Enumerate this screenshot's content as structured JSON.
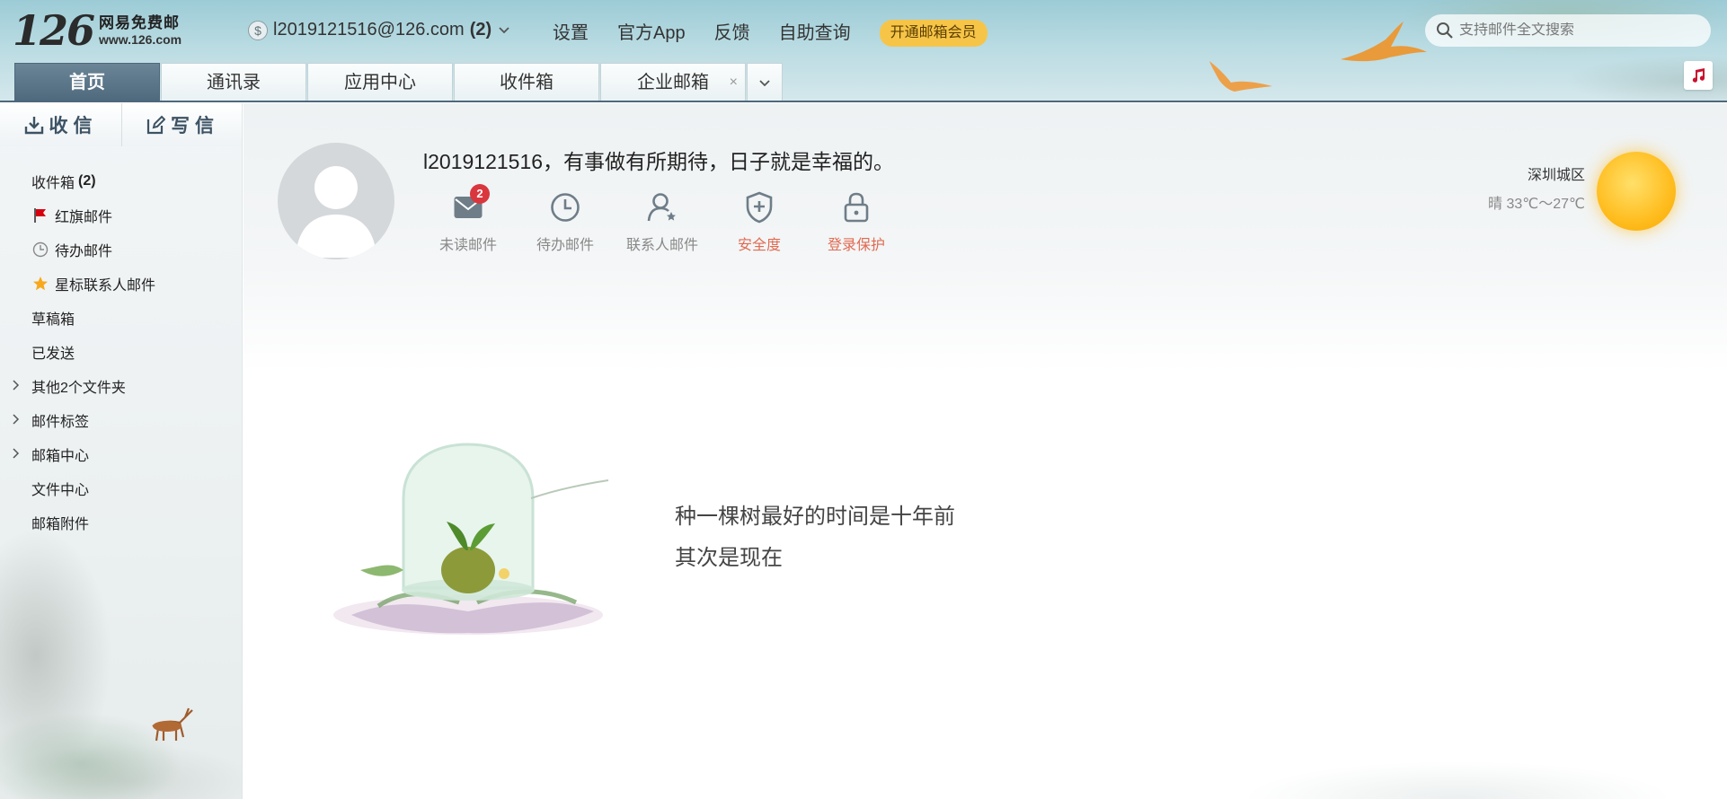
{
  "logo": {
    "number": "126",
    "line1": "网易免费邮",
    "line2": "www.126.com"
  },
  "account": {
    "email": "l2019121516@126.com",
    "count": "(2)"
  },
  "topnav": {
    "settings": "设置",
    "app": "官方App",
    "feedback": "反馈",
    "self_query": "自助查询",
    "vip": "开通邮箱会员"
  },
  "search": {
    "placeholder": "支持邮件全文搜索"
  },
  "tabs": [
    {
      "label": "首页"
    },
    {
      "label": "通讯录"
    },
    {
      "label": "应用中心"
    },
    {
      "label": "收件箱"
    },
    {
      "label": "企业邮箱"
    }
  ],
  "sidebar": {
    "receive": "收信",
    "compose": "写信",
    "folders": [
      {
        "label": "收件箱",
        "count": "(2)"
      },
      {
        "label": "红旗邮件"
      },
      {
        "label": "待办邮件"
      },
      {
        "label": "星标联系人邮件"
      },
      {
        "label": "草稿箱"
      },
      {
        "label": "已发送"
      },
      {
        "label": "其他2个文件夹"
      },
      {
        "label": "邮件标签"
      },
      {
        "label": "邮箱中心"
      },
      {
        "label": "文件中心"
      },
      {
        "label": "邮箱附件"
      }
    ]
  },
  "main": {
    "greeting": "l2019121516，有事做有所期待，日子就是幸福的。",
    "quick": [
      {
        "label": "未读邮件",
        "badge": "2"
      },
      {
        "label": "待办邮件"
      },
      {
        "label": "联系人邮件"
      },
      {
        "label": "安全度"
      },
      {
        "label": "登录保护"
      }
    ],
    "weather": {
      "city": "深圳城区",
      "temp": "晴 33℃～27℃"
    },
    "quote": {
      "line1": "种一棵树最好的时间是十年前",
      "line2": "其次是现在"
    }
  },
  "colors": {
    "header_bg": "#9ccbd6",
    "active_tab": "#4d687c",
    "vip": "#f6c548",
    "badge": "#d9363e",
    "warn": "#e06b52"
  }
}
